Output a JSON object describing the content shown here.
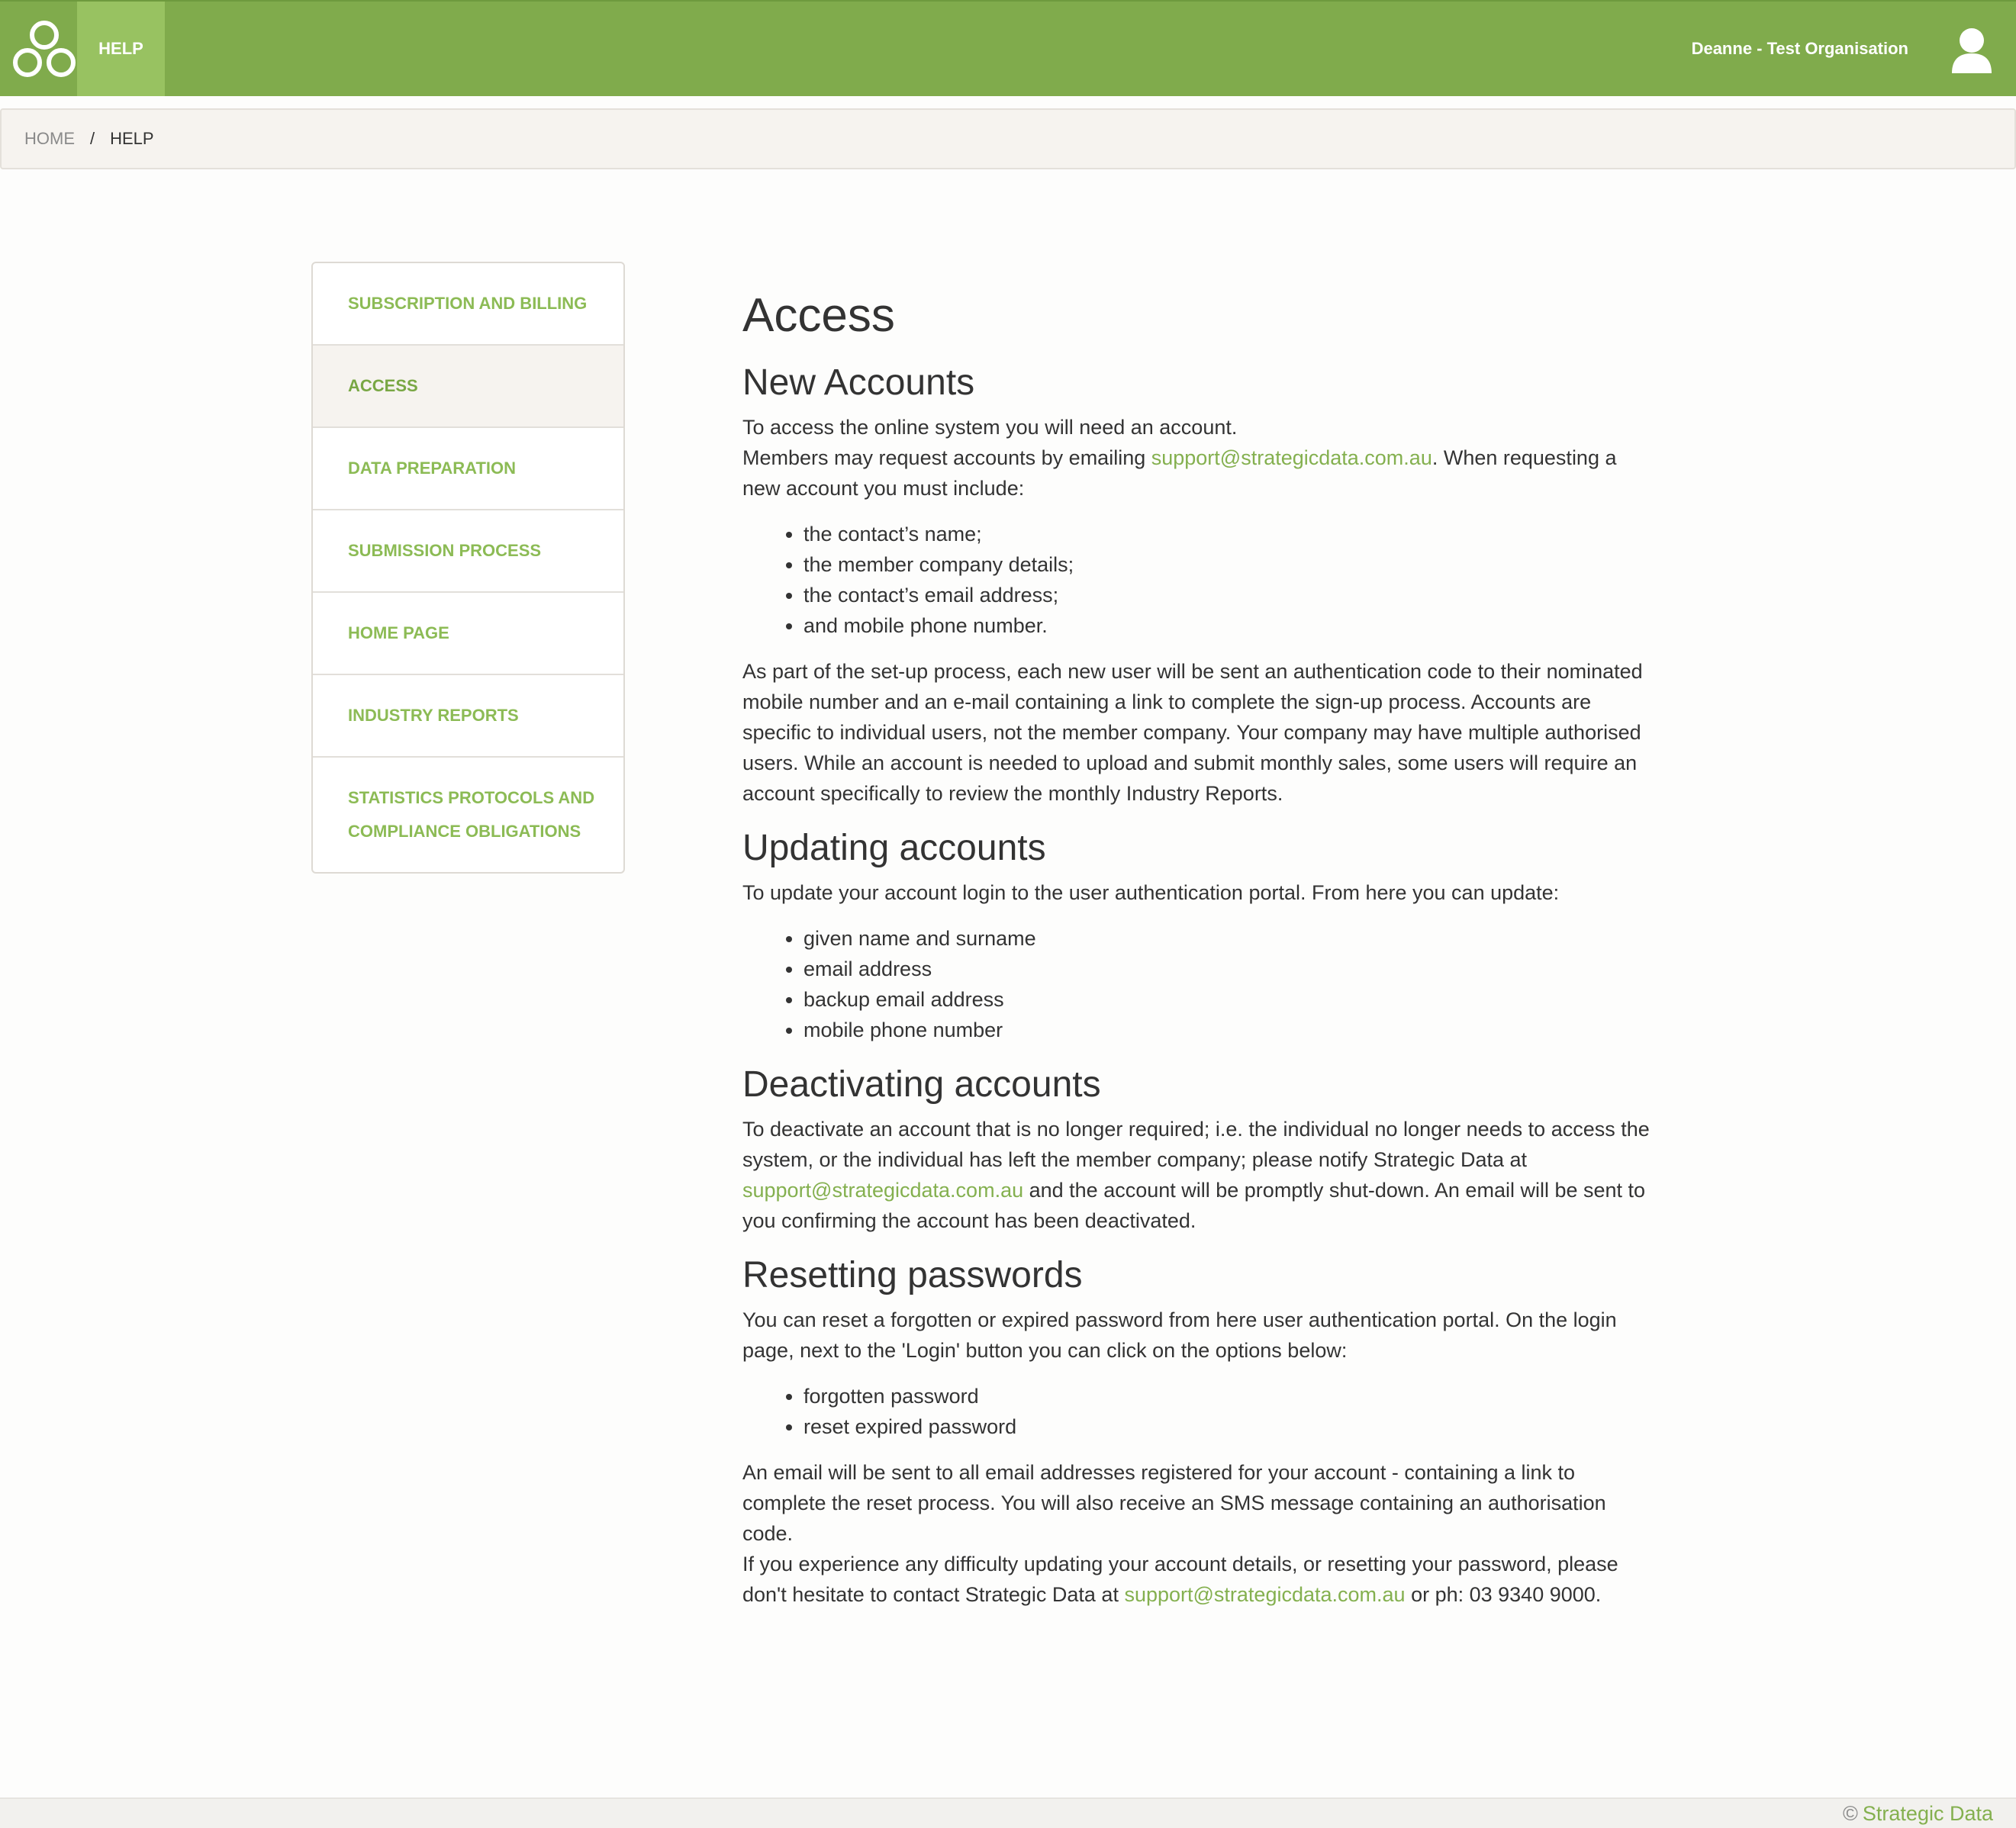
{
  "header": {
    "nav_help": "HELP",
    "user_name": "Deanne - Test Organisation",
    "logo_icon": "three-circles-logo",
    "user_icon": "user-avatar-icon",
    "brand_color": "#80ab4c"
  },
  "breadcrumb": {
    "home": "HOME",
    "separator": "/",
    "current": "HELP"
  },
  "sidebar": {
    "items": [
      {
        "label": "SUBSCRIPTION AND BILLING"
      },
      {
        "label": "ACCESS"
      },
      {
        "label": "DATA PREPARATION"
      },
      {
        "label": "SUBMISSION PROCESS"
      },
      {
        "label": "HOME PAGE"
      },
      {
        "label": "INDUSTRY REPORTS"
      },
      {
        "label": "STATISTICS PROTOCOLS AND COMPLIANCE OBLIGATIONS"
      }
    ],
    "active_index": 1
  },
  "main": {
    "title": "Access",
    "new_accounts": {
      "heading": "New Accounts",
      "line1": "To access the online system you will need an account.",
      "line2_pre": "Members may request accounts by emailing ",
      "email": "support@strategicdata.com.au",
      "line2_post": ". When requesting a new account you must include:",
      "list": [
        "the contact’s name;",
        "the member company details;",
        "the contact’s email address;",
        "and mobile phone number."
      ],
      "para": "As part of the set-up process, each new user will be sent an authentication code to their nominated mobile number and an e-mail containing a link to complete the sign-up process. Accounts are specific to individual users, not the member company. Your company may have multiple authorised users. While an account is needed to upload and submit monthly sales, some users will require an account specifically to review the monthly Industry Reports."
    },
    "updating": {
      "heading": "Updating accounts",
      "intro": "To update your account login to the user authentication portal. From here you can update:",
      "list": [
        "given name and surname",
        "email address",
        "backup email address",
        "mobile phone number"
      ]
    },
    "deactivating": {
      "heading": "Deactivating accounts",
      "pre": "To deactivate an account that is no longer required; i.e. the individual no longer needs to access the system, or the individual has left the member company; please notify Strategic Data at ",
      "email": "support@strategicdata.com.au",
      "post": " and the account will be promptly shut-down. An email will be sent to you confirming the account has been deactivated."
    },
    "resetting": {
      "heading": "Resetting passwords",
      "intro": "You can reset a forgotten or expired password from here user authentication portal. On the login page, next to the 'Login' button you can click on the options below:",
      "list": [
        "forgotten password",
        "reset expired password"
      ],
      "para1": "An email will be sent to all email addresses registered for your account - containing a link to complete the reset process. You will also receive an SMS message containing an authorisation code.",
      "para2_pre": "If you experience any difficulty updating your account details, or resetting your password, please don't hesitate to contact Strategic Data at ",
      "email": "support@strategicdata.com.au",
      "para2_post": " or ph: 03 9340 9000."
    }
  },
  "footer": {
    "copyright": "©",
    "brand": "Strategic Data"
  }
}
